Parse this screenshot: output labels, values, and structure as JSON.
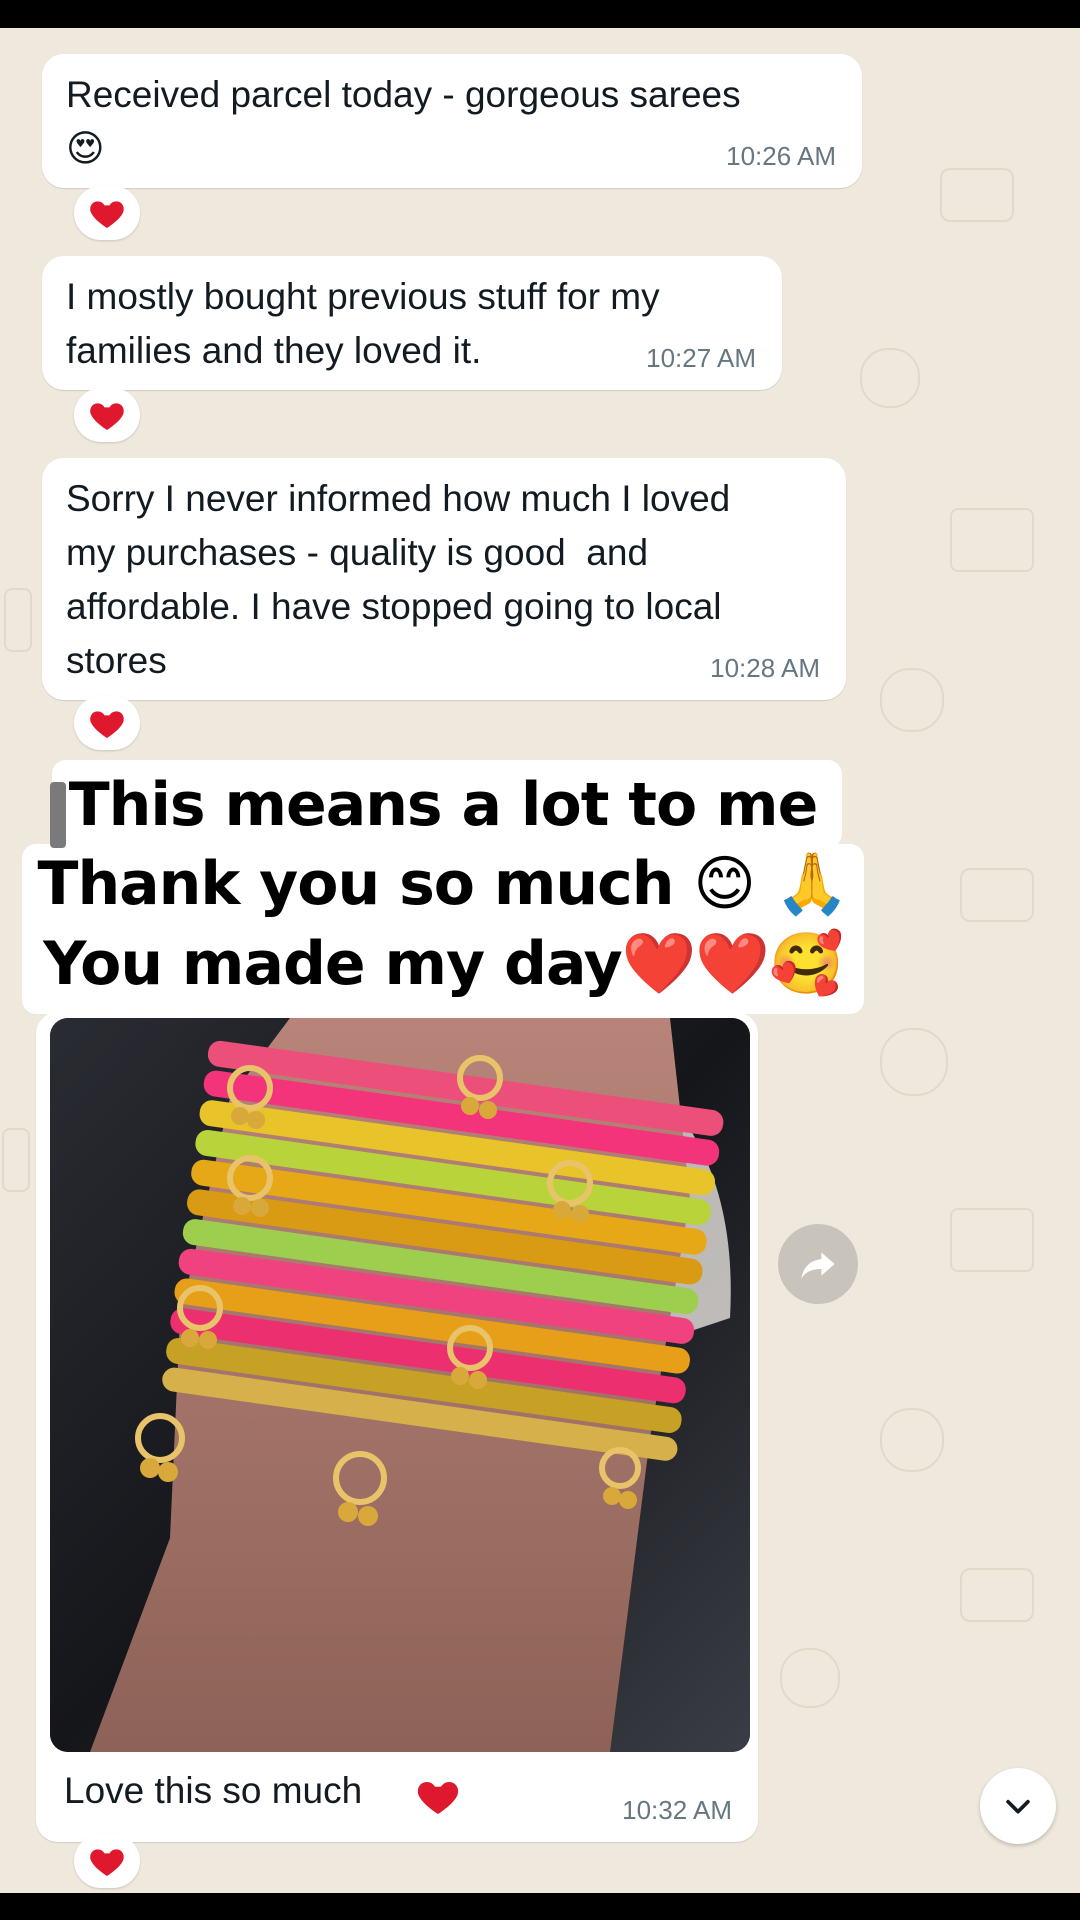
{
  "messages": [
    {
      "text": "Received parcel today - gorgeous sarees",
      "emoji": "😍",
      "time": "10:26 AM",
      "reaction": "heart"
    },
    {
      "text": "I mostly bought previous stuff for my\nfamilies and they loved it.",
      "time": "10:27 AM",
      "reaction": "heart"
    },
    {
      "text": "Sorry I never informed how much I loved\nmy purchases - quality is good  and\naffordable. I have stopped going to local\nstores",
      "time": "10:28 AM",
      "reaction": "heart"
    }
  ],
  "overlay": {
    "line1": "This means a lot to me",
    "line2": "Thank you so much  😊 🙏",
    "line3": "You made my day❤️❤️🥰"
  },
  "image_message": {
    "caption": "Love this so much",
    "time": "10:32 AM",
    "reaction": "heart",
    "photo_description_icon": "bangles-photo"
  },
  "icons": {
    "forward": "forward-icon",
    "scroll_down": "chevron-down-icon"
  },
  "colors": {
    "background": "#efe8dc",
    "bubble": "#ffffff",
    "timestamp": "#667781",
    "heart": "#e0182d"
  }
}
